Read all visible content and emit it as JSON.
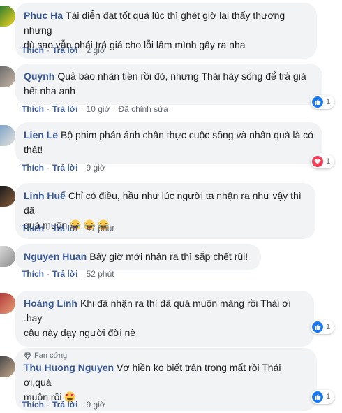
{
  "ui": {
    "like_label": "Thích",
    "reply_label": "Trả lời",
    "separator": "·"
  },
  "colors": {
    "author": "#385898",
    "bubble": "#f2f3f5",
    "like_blue": "#1877f2",
    "heart_red": "#f33e58"
  },
  "comments": [
    {
      "author": "Phuc Ha",
      "text_1": "Tái diễn đạt tốt quá lúc thì ghét giờ lại thấy thương nhưng",
      "text_2": "dù sao vẫn phải trả giá cho lỗi lầm mình gây ra nha",
      "time": "2 giờ"
    },
    {
      "author": "Quỳnh",
      "text_1": "Quả báo nhãn tiền rồi đó, nhưng Thái hãy sống để trả giá",
      "text_2": "hết nha anh",
      "time": "10 giờ",
      "edited": "Đã chỉnh sửa",
      "reaction": {
        "icon": "like-icon",
        "count": "1"
      }
    },
    {
      "author": "Lien Le",
      "text_1": "Bộ phim phản ánh chân thực cuộc sống và nhân quả là có",
      "text_2": "thật!",
      "time": "9 giờ",
      "reaction": {
        "icon": "heart-icon",
        "count": "1"
      }
    },
    {
      "author": "Linh Huế",
      "text_1": "Chỉ có điều, hầu như lúc người ta nhận ra như vậy thì đã",
      "text_2": "quá muộn",
      "emojis": [
        "laughing-emoji",
        "laughing-emoji",
        "laughing-emoji"
      ],
      "time": "47 phút"
    },
    {
      "author": "Nguyen Huan",
      "text_1": "Bây giờ mới nhận ra thì sắp chết rùi!",
      "time": "52 phút"
    },
    {
      "author": "Hoàng Linh",
      "text_1": "Khi đã nhận ra thì đã quá muộn màng rồi Thái ơi .hay",
      "text_2": "câu này dạy người đời nè",
      "time": "",
      "reaction": {
        "icon": "like-icon",
        "count": "1"
      }
    },
    {
      "author": "Thu Huong Nguyen",
      "badge": "Fan cứng",
      "text_1": "Vợ hiền ko biết trân trọng mất rồi Thái ơi,quá",
      "text_2": "muộn rồi",
      "emojis": [
        "heart-eyes-emoji"
      ],
      "time": "9 giờ",
      "reaction": {
        "icon": "like-icon",
        "count": "1"
      }
    }
  ]
}
